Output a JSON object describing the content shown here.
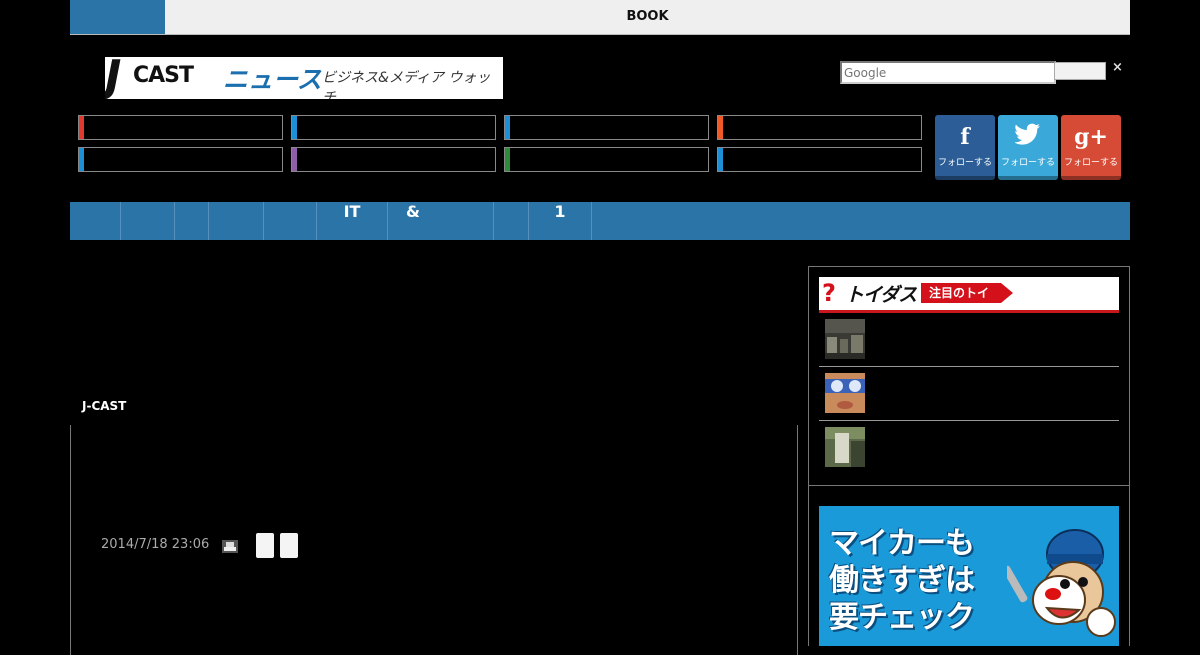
{
  "topbar": {
    "book_label": "BOOK"
  },
  "logo": {
    "j": "J",
    "cast": "CAST",
    "news": "ニュース",
    "tagline": "ビジネス&メディア ウォッチ"
  },
  "search": {
    "placeholder": "Google",
    "close": "×"
  },
  "categories": {
    "accent_colors": [
      "#e03a2e",
      "#1d8fd6",
      "#1d8fd6",
      "#f05a28",
      "#1d8fd6",
      "#8e5fa8",
      "#2e8b3a",
      "#1d8fd6"
    ]
  },
  "social": [
    {
      "name": "facebook",
      "glyph": "f",
      "label": "フォローする",
      "color": "#2c5d96"
    },
    {
      "name": "twitter",
      "glyph": "🐦",
      "label": "フォローする",
      "color": "#3aa8d8"
    },
    {
      "name": "googleplus",
      "glyph": "g+",
      "label": "フォローする",
      "color": "#d64b35"
    }
  ],
  "nav": [
    "",
    "",
    "",
    "",
    "",
    "IT",
    "&",
    "",
    "1",
    ""
  ],
  "article": {
    "source": "J-CAST",
    "date": "2014/7/18 23:06"
  },
  "sidebar": {
    "toigus": {
      "mark": "?",
      "logo": "トイダス",
      "badge": "注目のトイ"
    }
  },
  "ad": {
    "lines": [
      "マイカーも",
      "働きすぎは",
      "要チェック"
    ]
  },
  "colors": {
    "brand_blue": "#2b74a8",
    "toigus_red": "#d4111b",
    "ad_blue": "#1a9ad9"
  }
}
